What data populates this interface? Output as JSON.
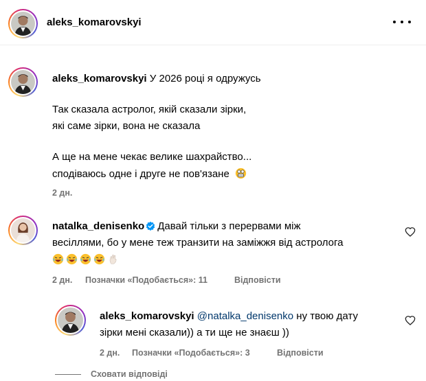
{
  "header": {
    "username": "aleks_komarovskyi"
  },
  "post": {
    "username": "aleks_komarovskyi",
    "first_line": "У 2026 році я одружусь",
    "lines": [
      "Так сказала астролог, якій сказали зірки,",
      "які саме зірки, вона не сказала",
      "А ще на мене чекає велике шахрайство...",
      "сподіваюсь одне і друге не пов'язане"
    ],
    "time": "2 дн."
  },
  "comment": {
    "username": "natalka_denisenko",
    "text_line1": "Давай тільки з перервами між",
    "text_line2": "весіллями, бо у мене теж транзити на заміжжя від астролога",
    "time": "2 дн.",
    "likes": "Позначки «Подобається»: 11",
    "reply": "Відповісти"
  },
  "reply": {
    "username": "aleks_komarovskyi",
    "mention": "@natalka_denisenko",
    "text_line1": "ну твою дату",
    "text_line2": "зірки мені сказали)) а ти ще не знаєш ))",
    "time": "2 дн.",
    "likes": "Позначки «Подобається»: 3",
    "reply": "Відповісти"
  },
  "hide_replies": "Сховати відповіді",
  "icons": {
    "more": "more-horizontal-icon",
    "heart": "heart-outline-icon",
    "verified": "verified-badge-icon",
    "emoji_laugh": "laughing-emoji-icon",
    "emoji_hand": "ok-hand-emoji-icon",
    "emoji_cringe": "grimace-emoji-icon"
  },
  "colors": {
    "muted": "#737373",
    "mention": "#00376b",
    "verified": "#0095f6"
  }
}
